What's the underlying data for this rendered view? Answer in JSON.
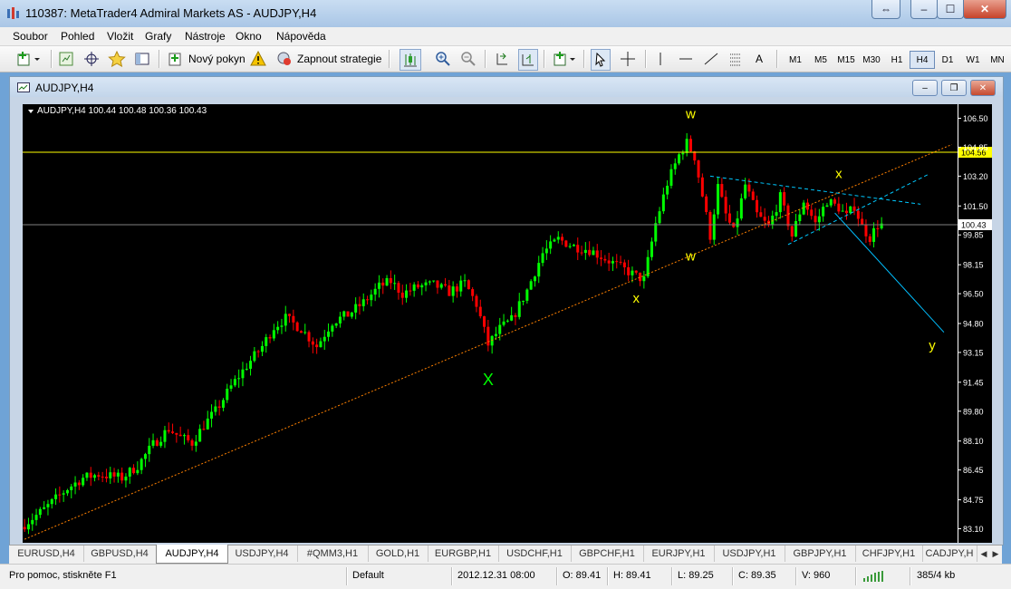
{
  "window": {
    "title": "110387: MetaTrader4 Admiral Markets AS - AUDJPY,H4",
    "icon": "metatrader-chart-icon",
    "buttons": {
      "restore": "⇔",
      "minimize": "–",
      "maximize": "☐",
      "close": "✕"
    }
  },
  "menu": [
    "Soubor",
    "Pohled",
    "Vložit",
    "Grafy",
    "Nástroje",
    "Okno",
    "Nápověda"
  ],
  "toolbar": {
    "new_order": "Nový pokyn",
    "autotrading": "Zapnout strategie",
    "line_tool_text": "A",
    "timeframes": [
      "M1",
      "M5",
      "M15",
      "M30",
      "H1",
      "H4",
      "D1",
      "W1",
      "MN"
    ],
    "active_timeframe": "H4"
  },
  "chart_window": {
    "title": "AUDJPY,H4",
    "info_line": "AUDJPY,H4  100.44 100.48 100.36 100.43",
    "buttons": {
      "minimize": "–",
      "restore": "❐",
      "close": "✕"
    }
  },
  "chart_data": {
    "type": "candlestick",
    "symbol": "AUDJPY",
    "timeframe": "H4",
    "ylim": [
      82.3,
      107.3
    ],
    "y_ticks": [
      "106.50",
      "104.85",
      "103.20",
      "101.50",
      "99.85",
      "98.15",
      "96.50",
      "94.80",
      "93.15",
      "91.45",
      "89.80",
      "88.10",
      "86.45",
      "84.75",
      "83.10"
    ],
    "price_path": [
      [
        0,
        83.2
      ],
      [
        6,
        84.2
      ],
      [
        12,
        85.4
      ],
      [
        16,
        86.0
      ],
      [
        20,
        86.2
      ],
      [
        26,
        86.0
      ],
      [
        30,
        86.7
      ],
      [
        34,
        87.9
      ],
      [
        38,
        88.8
      ],
      [
        41,
        88.3
      ],
      [
        44,
        88.0
      ],
      [
        47,
        89.0
      ],
      [
        50,
        89.8
      ],
      [
        54,
        91.2
      ],
      [
        58,
        92.4
      ],
      [
        62,
        93.5
      ],
      [
        65,
        94.6
      ],
      [
        68,
        95.1
      ],
      [
        72,
        94.5
      ],
      [
        76,
        93.5
      ],
      [
        80,
        94.9
      ],
      [
        84,
        95.3
      ],
      [
        88,
        96.0
      ],
      [
        92,
        96.9
      ],
      [
        95,
        97.2
      ],
      [
        98,
        96.5
      ],
      [
        102,
        96.9
      ],
      [
        106,
        97.0
      ],
      [
        110,
        96.6
      ],
      [
        114,
        97.1
      ],
      [
        117,
        95.9
      ],
      [
        120,
        93.6
      ],
      [
        123,
        94.5
      ],
      [
        126,
        95.0
      ],
      [
        130,
        96.7
      ],
      [
        134,
        98.8
      ],
      [
        138,
        99.6
      ],
      [
        142,
        99.2
      ],
      [
        146,
        99.0
      ],
      [
        150,
        98.5
      ],
      [
        154,
        98.0
      ],
      [
        158,
        97.5
      ],
      [
        160,
        97.3
      ],
      [
        163,
        100.5
      ],
      [
        166,
        102.8
      ],
      [
        169,
        104.4
      ],
      [
        171,
        105.1
      ],
      [
        173,
        104.3
      ],
      [
        175,
        102.1
      ],
      [
        177,
        99.8
      ],
      [
        179,
        102.6
      ],
      [
        181,
        101.0
      ],
      [
        183,
        100.0
      ],
      [
        186,
        102.7
      ],
      [
        189,
        101.0
      ],
      [
        192,
        100.3
      ],
      [
        195,
        102.0
      ],
      [
        198,
        99.8
      ],
      [
        201,
        101.8
      ],
      [
        204,
        100.5
      ],
      [
        207,
        101.8
      ],
      [
        210,
        101.4
      ],
      [
        212,
        100.9
      ],
      [
        214,
        101.5
      ],
      [
        216,
        100.3
      ],
      [
        218,
        99.7
      ],
      [
        220,
        100.43
      ]
    ],
    "horizontal_lines": [
      {
        "price": 104.56,
        "label": "104.56",
        "color": "#ffff00"
      },
      {
        "price": 100.43,
        "label": "100.43",
        "color": "#808080"
      }
    ],
    "trendlines": [
      {
        "from": [
          0,
          82.5
        ],
        "to": [
          238,
          105.0
        ],
        "color": "#ff8000",
        "style": "dotted"
      },
      {
        "from": [
          176,
          103.2
        ],
        "to": [
          230,
          101.6
        ],
        "color": "#00c8ff",
        "style": "dashed"
      },
      {
        "from": [
          196,
          99.3
        ],
        "to": [
          232,
          103.3
        ],
        "color": "#00c8ff",
        "style": "dashed"
      },
      {
        "from": [
          208,
          101.1
        ],
        "to": [
          236,
          94.3
        ],
        "color": "#00bfff",
        "style": "solid"
      }
    ],
    "annotations": [
      {
        "text": "w",
        "at": [
          171,
          106.5
        ],
        "color": "#ffff00"
      },
      {
        "text": "x",
        "at": [
          209,
          103.1
        ],
        "color": "#ffff00"
      },
      {
        "text": "w",
        "at": [
          171,
          98.4
        ],
        "color": "#ffff00"
      },
      {
        "text": "x",
        "at": [
          157,
          96.0
        ],
        "color": "#ffff00"
      },
      {
        "text": "y",
        "at": [
          233,
          93.3
        ],
        "color": "#ffff00"
      },
      {
        "text": "X",
        "at": [
          119,
          91.3
        ],
        "color": "#00ff00"
      }
    ],
    "colors": {
      "up": "#00ff00",
      "down": "#ff0000",
      "background": "#000000",
      "axis": "#ffffff"
    }
  },
  "tabs": [
    "EURUSD,H4",
    "GBPUSD,H4",
    "AUDJPY,H4",
    "USDJPY,H4",
    "#QMM3,H1",
    "GOLD,H1",
    "EURGBP,H1",
    "USDCHF,H1",
    "GBPCHF,H1",
    "EURJPY,H1",
    "USDJPY,H1",
    "GBPJPY,H1",
    "CHFJPY,H1",
    "CADJPY,H"
  ],
  "active_tab": "AUDJPY,H4",
  "status": {
    "help": "Pro pomoc, stiskněte F1",
    "profile": "Default",
    "datetime": "2012.12.31 08:00",
    "open": "O: 89.41",
    "high": "H: 89.41",
    "low": "L: 89.25",
    "close": "C: 89.35",
    "volume": "V: 960",
    "traffic": "385/4 kb"
  }
}
